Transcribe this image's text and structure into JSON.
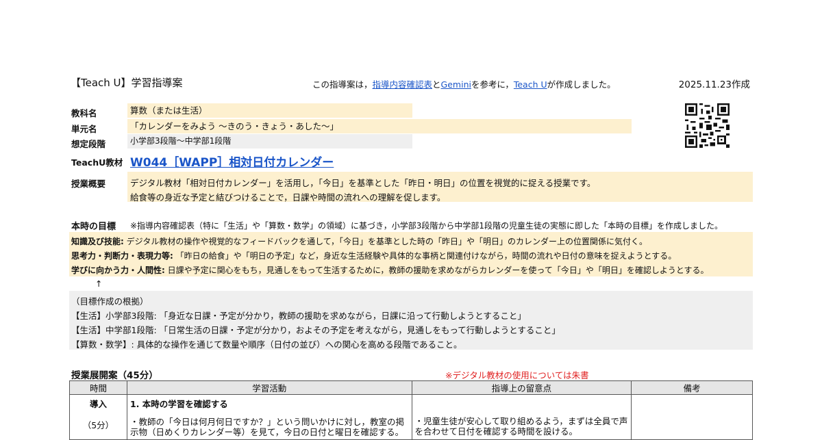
{
  "header": {
    "title": "【Teach U】学習指導案",
    "note_prefix": "この指導案は，",
    "note_link1": "指導内容確認表",
    "note_mid1": "と",
    "note_link2": "Gemini",
    "note_mid2": "を参考に，",
    "note_link3": "Teach U",
    "note_suffix": "が作成しました。",
    "date": "2025.11.23作成"
  },
  "info": {
    "subject_label": "教科名",
    "subject": "算数（または生活）",
    "unit_label": "単元名",
    "unit": "「カレンダーをみよう ～きのう・きょう・あした～」",
    "level_label": "想定段階",
    "level": "小学部3段階～中学部1段階",
    "material_label": "TeachU教材",
    "material": "W044［WAPP］相対日付カレンダー",
    "overview_label": "授業概要",
    "overview_line1": "デジタル教材「相対日付カレンダー」を活用し，「今日」を基準とした「昨日・明日」の位置を視覚的に捉える授業です。",
    "overview_line2": "給食等の身近な予定と結びつけることで，日課や時間の流れへの理解を促します。"
  },
  "goals": {
    "label": "本時の目標",
    "note": "※指導内容確認表（特に「生活」や「算数・数学」の領域）に基づき，小学部3段階から中学部1段階の児童生徒の実態に即した「本時の目標」を作成しました。",
    "knowledge_label": "知識及び技能:",
    "knowledge": " デジタル教材の操作や視覚的なフィードバックを通して，「今日」を基準とした時の「昨日」や「明日」のカレンダー上の位置関係に気付く。",
    "thinking_label": "思考力・判断力・表現力等:",
    "thinking": " 「昨日の給食」や「明日の予定」など，身近な生活経験や具体的な事柄と関連付けながら，時間の流れや日付の意味を捉えようとする。",
    "attitude_label": "学びに向かう力・人間性:",
    "attitude": " 日課や予定に関心をもち，見通しをもって生活するために，教師の援助を求めながらカレンダーを使って「今日」や「明日」を確認しようとする。",
    "arrow": "↑"
  },
  "basis": {
    "heading": "（目標作成の根拠）",
    "line1": "【生活】小学部3段階: 「身近な日課・予定が分かり，教師の援助を求めながら，日課に沿って行動しようとすること」",
    "line2": "【生活】中学部1段階: 「日常生活の日課・予定が分かり，およその予定を考えながら，見通しをもって行動しようとすること」",
    "line3": "【算数・数学】: 具体的な操作を通じて数量や順序（日付の並び）への関心を高める段階であること。"
  },
  "plan": {
    "heading": "授業展開案（45分）",
    "red_note": "※デジタル教材の使用については朱書",
    "columns": [
      "時間",
      "学習活動",
      "指導上の留意点",
      "備考"
    ],
    "row1": {
      "time1": "導入",
      "time2": "（5分）",
      "activity_title": "1. 本時の学習を確認する",
      "activity_text": "・教師の「今日は何月何日ですか？」という問いかけに対し，教室の掲示物（日めくりカレンダー等）を見て，今日の日付と曜日を確認する。",
      "point_text": "・児童生徒が安心して取り組めるよう，まずは全員で声を合わせて日付を確認する時間を設ける。",
      "remarks": ""
    }
  }
}
